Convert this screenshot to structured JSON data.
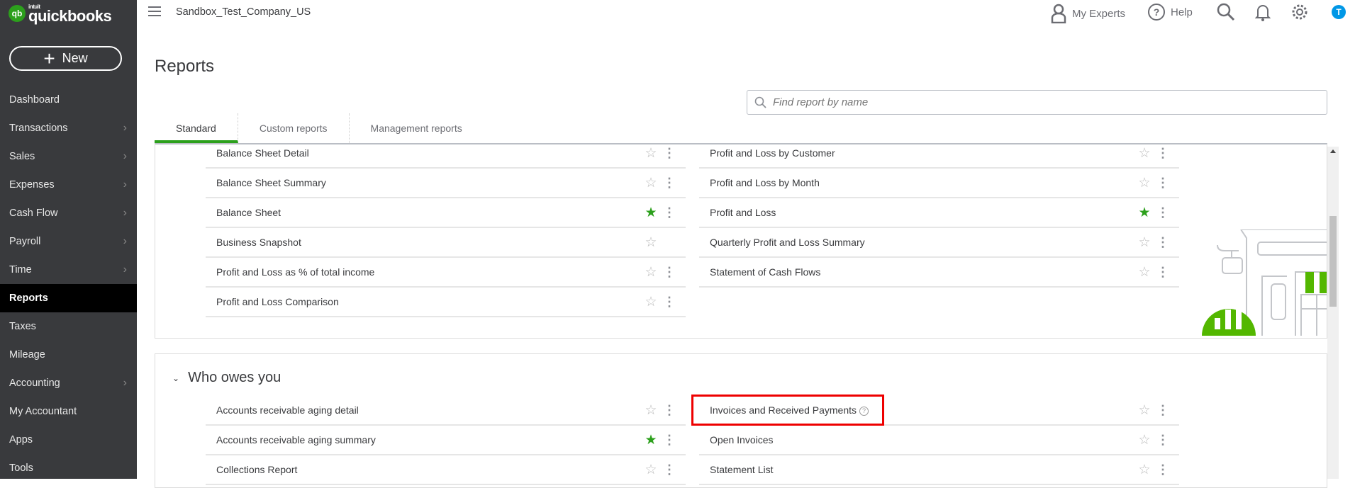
{
  "sidebar": {
    "logo_small": "intuit",
    "logo": "quickbooks",
    "new_label": "New",
    "items": [
      {
        "label": "Dashboard",
        "chevron": false
      },
      {
        "label": "Transactions",
        "chevron": true
      },
      {
        "label": "Sales",
        "chevron": true
      },
      {
        "label": "Expenses",
        "chevron": true
      },
      {
        "label": "Cash Flow",
        "chevron": true
      },
      {
        "label": "Payroll",
        "chevron": true
      },
      {
        "label": "Time",
        "chevron": true
      },
      {
        "label": "Reports",
        "chevron": false,
        "active": true
      },
      {
        "label": "Taxes",
        "chevron": false
      },
      {
        "label": "Mileage",
        "chevron": false
      },
      {
        "label": "Accounting",
        "chevron": true
      },
      {
        "label": "My Accountant",
        "chevron": false
      },
      {
        "label": "Apps",
        "chevron": false
      },
      {
        "label": "Tools",
        "chevron": false
      }
    ]
  },
  "topbar": {
    "company": "Sandbox_Test_Company_US",
    "my_experts": "My Experts",
    "help": "Help",
    "avatar_initial": "T"
  },
  "page": {
    "title": "Reports",
    "search_placeholder": "Find report by name",
    "tabs": [
      {
        "label": "Standard",
        "active": true
      },
      {
        "label": "Custom reports"
      },
      {
        "label": "Management reports"
      }
    ]
  },
  "section1": {
    "left": [
      {
        "name": "Balance Sheet Detail",
        "fav": false,
        "menu": true
      },
      {
        "name": "Balance Sheet Summary",
        "fav": false,
        "menu": true
      },
      {
        "name": "Balance Sheet",
        "fav": true,
        "menu": true
      },
      {
        "name": "Business Snapshot",
        "fav": false,
        "menu": false
      },
      {
        "name": "Profit and Loss as % of total income",
        "fav": false,
        "menu": true
      },
      {
        "name": "Profit and Loss Comparison",
        "fav": false,
        "menu": true
      }
    ],
    "right": [
      {
        "name": "Profit and Loss by Customer",
        "fav": false,
        "menu": true
      },
      {
        "name": "Profit and Loss by Month",
        "fav": false,
        "menu": true
      },
      {
        "name": "Profit and Loss",
        "fav": true,
        "menu": true
      },
      {
        "name": "Quarterly Profit and Loss Summary",
        "fav": false,
        "menu": true
      },
      {
        "name": "Statement of Cash Flows",
        "fav": false,
        "menu": true
      }
    ]
  },
  "section2": {
    "title": "Who owes you",
    "left": [
      {
        "name": "Accounts receivable aging detail",
        "fav": false
      },
      {
        "name": "Accounts receivable aging summary",
        "fav": true
      },
      {
        "name": "Collections Report",
        "fav": false
      }
    ],
    "right": [
      {
        "name": "Invoices and Received Payments",
        "fav": false,
        "highlighted": true
      },
      {
        "name": "Open Invoices",
        "fav": false
      },
      {
        "name": "Statement List",
        "fav": false
      }
    ]
  },
  "colors": {
    "brand_green": "#2ca01c",
    "sidebar": "#393a3d",
    "highlight": "#e00000",
    "avatar": "#0097e6"
  }
}
